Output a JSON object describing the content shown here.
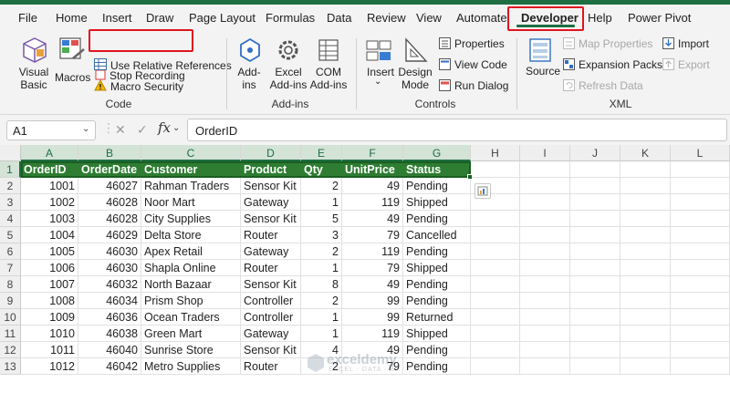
{
  "menu": {
    "tabs": [
      "File",
      "Home",
      "Insert",
      "Draw",
      "Page Layout",
      "Formulas",
      "Data",
      "Review",
      "View",
      "Automate",
      "Developer",
      "Help",
      "Power Pivot"
    ],
    "active": "Developer"
  },
  "ribbon": {
    "code": {
      "visual_basic": [
        "Visual",
        "Basic"
      ],
      "macros": "Macros",
      "stop_recording": "Stop Recording",
      "relative_refs": "Use Relative References",
      "macro_security": "Macro Security",
      "label": "Code"
    },
    "addins": {
      "addins": [
        "Add-",
        "ins"
      ],
      "excel_addins": [
        "Excel",
        "Add-ins"
      ],
      "com_addins": [
        "COM",
        "Add-ins"
      ],
      "label": "Add-ins"
    },
    "controls": {
      "insert": "Insert",
      "design_mode": [
        "Design",
        "Mode"
      ],
      "properties": "Properties",
      "view_code": "View Code",
      "run_dialog": "Run Dialog",
      "label": "Controls"
    },
    "xml": {
      "source": "Source",
      "map_properties": "Map Properties",
      "expansion_packs": "Expansion Packs",
      "refresh_data": "Refresh Data",
      "import": "Import",
      "export": "Export",
      "label": "XML"
    }
  },
  "formula_bar": {
    "name_box": "A1",
    "fx": "fx",
    "content": "OrderID"
  },
  "grid": {
    "columns": [
      "A",
      "B",
      "C",
      "D",
      "E",
      "F",
      "G",
      "H",
      "I",
      "J",
      "K",
      "L"
    ],
    "rows": [
      "1",
      "2",
      "3",
      "4",
      "5",
      "6",
      "7",
      "8",
      "9",
      "10",
      "11",
      "12",
      "13"
    ],
    "header": [
      "OrderID",
      "OrderDate",
      "Customer",
      "Product",
      "Qty",
      "UnitPrice",
      "Status"
    ],
    "data": [
      [
        "1001",
        "46027",
        "Rahman Traders",
        "Sensor Kit",
        "2",
        "49",
        "Pending"
      ],
      [
        "1002",
        "46028",
        "Noor Mart",
        "Gateway",
        "1",
        "119",
        "Shipped"
      ],
      [
        "1003",
        "46028",
        "City Supplies",
        "Sensor Kit",
        "5",
        "49",
        "Pending"
      ],
      [
        "1004",
        "46029",
        "Delta Store",
        "Router",
        "3",
        "79",
        "Cancelled"
      ],
      [
        "1005",
        "46030",
        "Apex Retail",
        "Gateway",
        "2",
        "119",
        "Pending"
      ],
      [
        "1006",
        "46030",
        "Shapla Online",
        "Router",
        "1",
        "79",
        "Shipped"
      ],
      [
        "1007",
        "46032",
        "North Bazaar",
        "Sensor Kit",
        "8",
        "49",
        "Pending"
      ],
      [
        "1008",
        "46034",
        "Prism Shop",
        "Controller",
        "2",
        "99",
        "Pending"
      ],
      [
        "1009",
        "46036",
        "Ocean Traders",
        "Controller",
        "1",
        "99",
        "Returned"
      ],
      [
        "1010",
        "46038",
        "Green Mart",
        "Gateway",
        "1",
        "119",
        "Shipped"
      ],
      [
        "1011",
        "46040",
        "Sunrise Store",
        "Sensor Kit",
        "4",
        "49",
        "Pending"
      ],
      [
        "1012",
        "46042",
        "Metro Supplies",
        "Router",
        "2",
        "79",
        "Pending"
      ]
    ]
  },
  "watermark": {
    "title": "exceldemy",
    "subtitle": "EXCEL · DATA · BI"
  },
  "colors": {
    "accent_green": "#1e6e42",
    "header_fill": "#2e7d32",
    "highlight_red": "#e0141e"
  }
}
